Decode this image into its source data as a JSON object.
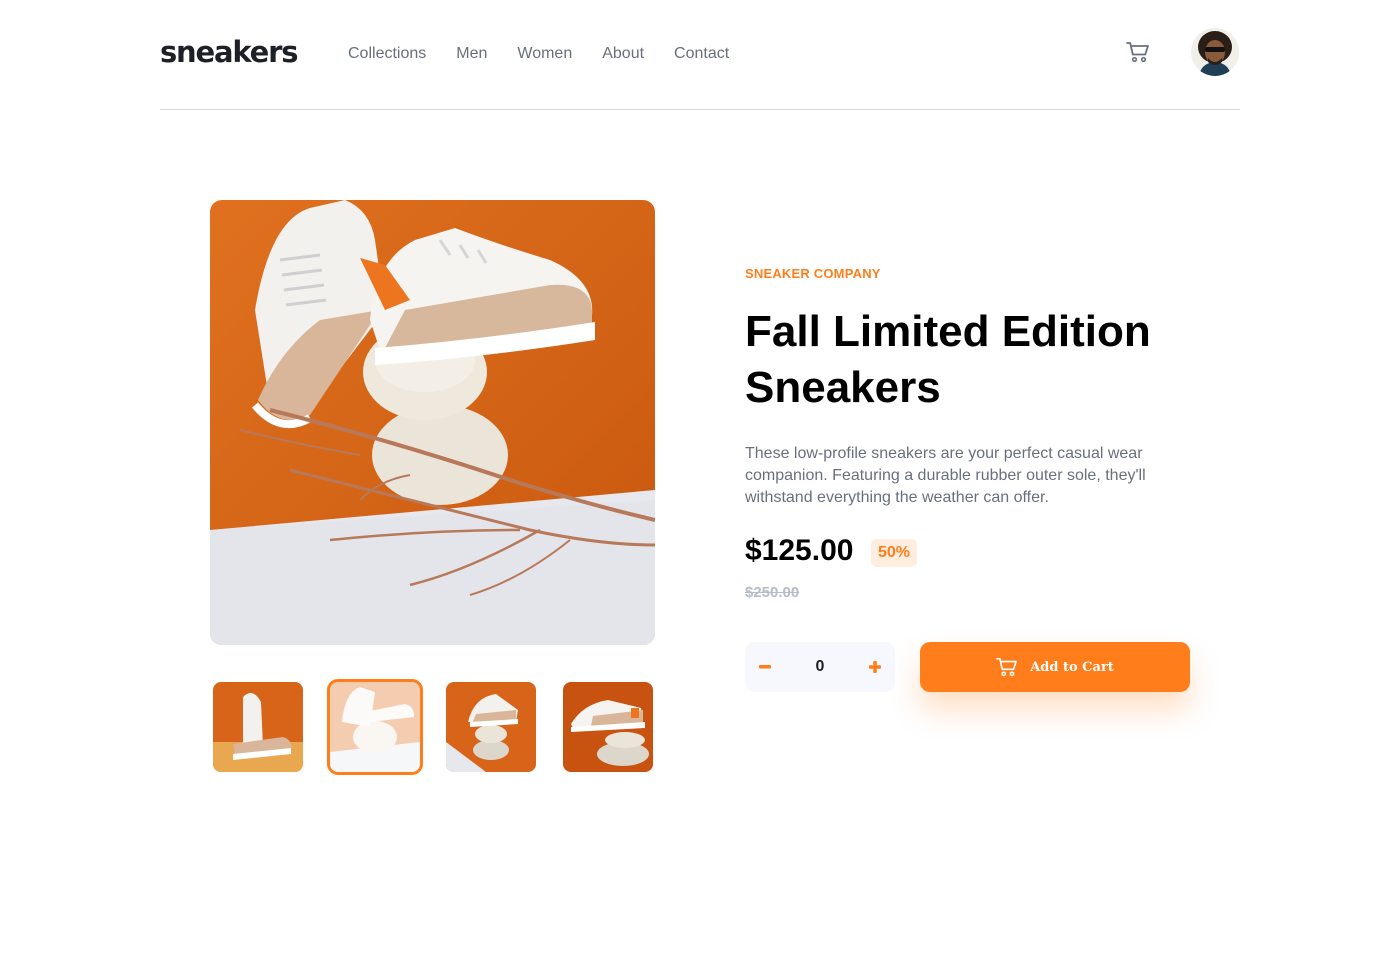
{
  "header": {
    "logo": "sneakers",
    "nav": [
      "Collections",
      "Men",
      "Women",
      "About",
      "Contact"
    ],
    "cart_icon": "cart-icon",
    "avatar_icon": "user-avatar"
  },
  "gallery": {
    "main_image": "sneakers-on-stones-with-branch",
    "thumbnails": [
      "thumbnail-1",
      "thumbnail-2",
      "thumbnail-3",
      "thumbnail-4"
    ],
    "active_thumbnail": 1
  },
  "product": {
    "company": "SNEAKER COMPANY",
    "title": "Fall Limited Edition Sneakers",
    "description": "These low-profile sneakers are your perfect casual wear companion. Featuring a durable rubber outer sole, they'll withstand everything the weather can offer.",
    "price": "$125.00",
    "discount": "50%",
    "original_price": "$250.00"
  },
  "quantity": {
    "minus_icon": "minus-icon",
    "plus_icon": "plus-icon",
    "value": "0"
  },
  "cart_button": {
    "label": "Add to Cart",
    "icon": "cart-icon"
  },
  "colors": {
    "accent": "#ff7e1b",
    "accent_light": "#ffede0",
    "text_dark": "#1d2026",
    "text_muted": "#69707d",
    "text_faint": "#b6bcc8",
    "surface": "#f6f8fd"
  }
}
